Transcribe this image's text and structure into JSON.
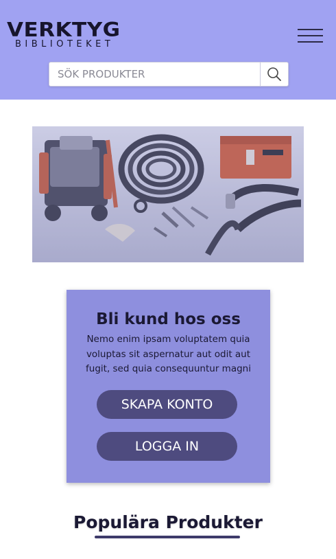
{
  "header": {
    "logo_main": "VERKTYG",
    "logo_sub": "BIBLIOTEKET",
    "menu_icon": "hamburger-menu-icon",
    "search": {
      "placeholder": "SÖK PRODUKTER",
      "value": "",
      "icon": "search-icon"
    },
    "background_color": "#a0a2f2"
  },
  "hero": {
    "description": "Tool image: drain cleaning machine, cable coil, toolbox and accessories"
  },
  "signup_card": {
    "title": "Bli kund hos oss",
    "text": "Nemo enim ipsam voluptatem quia voluptas sit aspernatur aut odit aut fugit, sed quia consequuntur magni",
    "create_account_label": "SKAPA KONTO",
    "login_label": "LOGGA IN",
    "card_color": "#8e8fde",
    "button_color": "#4e4b7f"
  },
  "popular": {
    "title": "Populära Produkter"
  }
}
